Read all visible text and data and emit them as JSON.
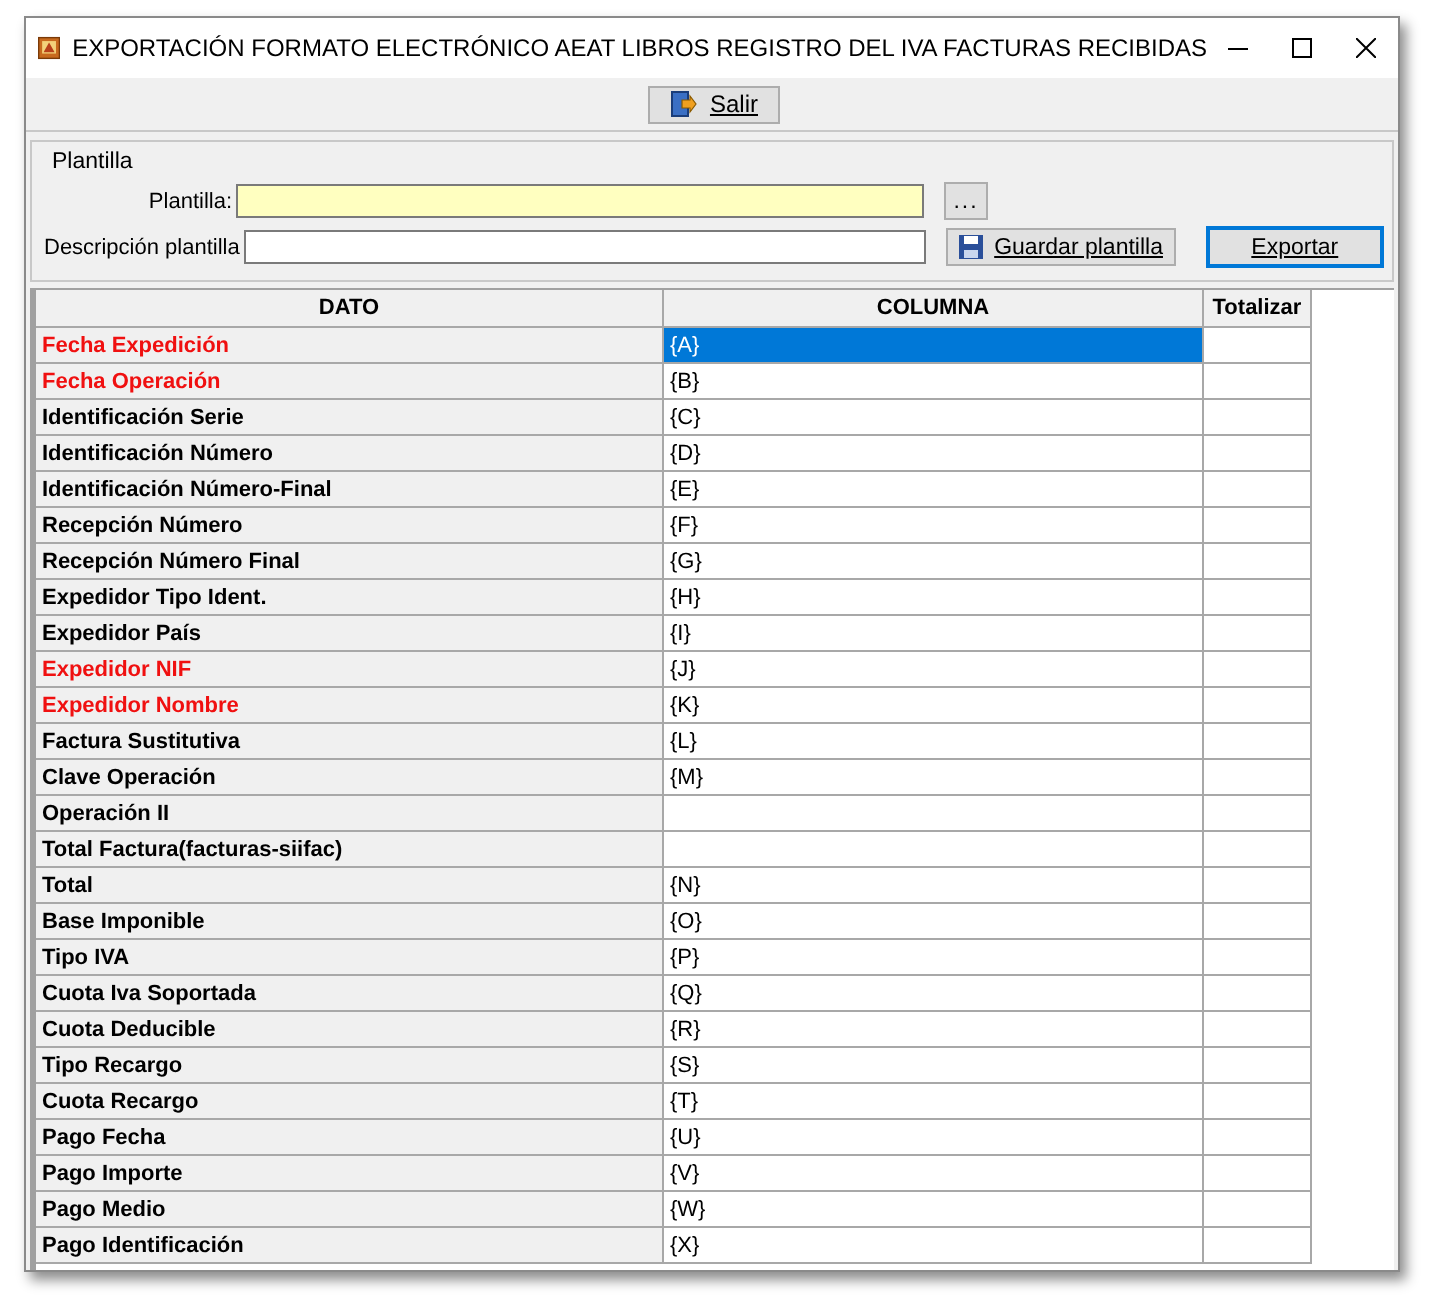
{
  "window": {
    "title": "EXPORTACIÓN FORMATO ELECTRÓNICO AEAT LIBROS REGISTRO DEL IVA FACTURAS RECIBIDAS"
  },
  "toolbar": {
    "exit_button": "Salir"
  },
  "template_group": {
    "title": "Plantilla",
    "template_label": "Plantilla:",
    "browse_button": "...",
    "description_label": "Descripción plantilla",
    "save_button": "Guardar plantilla",
    "export_button": "Exportar"
  },
  "table": {
    "columns": [
      "DATO",
      "COLUMNA",
      "Totalizar"
    ],
    "rows": [
      {
        "dato": "Fecha Expedición",
        "columna": "{A}",
        "required": true,
        "selected": true
      },
      {
        "dato": "Fecha Operación",
        "columna": "{B}",
        "required": true,
        "selected": false
      },
      {
        "dato": "Identificación Serie",
        "columna": "{C}",
        "required": false,
        "selected": false
      },
      {
        "dato": "Identificación Número",
        "columna": "{D}",
        "required": false,
        "selected": false
      },
      {
        "dato": "Identificación Número-Final",
        "columna": "{E}",
        "required": false,
        "selected": false
      },
      {
        "dato": "Recepción Número",
        "columna": "{F}",
        "required": false,
        "selected": false
      },
      {
        "dato": "Recepción Número Final",
        "columna": "{G}",
        "required": false,
        "selected": false
      },
      {
        "dato": "Expedidor Tipo Ident.",
        "columna": "{H}",
        "required": false,
        "selected": false
      },
      {
        "dato": "Expedidor País",
        "columna": "{I}",
        "required": false,
        "selected": false
      },
      {
        "dato": "Expedidor NIF",
        "columna": "{J}",
        "required": true,
        "selected": false
      },
      {
        "dato": "Expedidor Nombre",
        "columna": "{K}",
        "required": true,
        "selected": false
      },
      {
        "dato": "Factura Sustitutiva",
        "columna": "{L}",
        "required": false,
        "selected": false
      },
      {
        "dato": "Clave Operación",
        "columna": "{M}",
        "required": false,
        "selected": false
      },
      {
        "dato": "Operación II",
        "required": false,
        "selected": false
      },
      {
        "dato": "Total Factura(facturas-siifac)",
        "required": false,
        "selected": false
      },
      {
        "dato": "Total",
        "columna": "{N}",
        "required": false,
        "selected": false
      },
      {
        "dato": "Base Imponible",
        "columna": "{O}",
        "required": false,
        "selected": false
      },
      {
        "dato": "Tipo IVA",
        "columna": "{P}",
        "required": false,
        "selected": false
      },
      {
        "dato": "Cuota Iva Soportada",
        "columna": "{Q}",
        "required": false,
        "selected": false
      },
      {
        "dato": "Cuota Deducible",
        "columna": "{R}",
        "required": false,
        "selected": false
      },
      {
        "dato": "Tipo Recargo",
        "columna": "{S}",
        "required": false,
        "selected": false
      },
      {
        "dato": "Cuota Recargo",
        "columna": "{T}",
        "required": false,
        "selected": false
      },
      {
        "dato": "Pago Fecha",
        "columna": "{U}",
        "required": false,
        "selected": false
      },
      {
        "dato": "Pago Importe",
        "columna": "{V}",
        "required": false,
        "selected": false
      },
      {
        "dato": "Pago Medio",
        "columna": "{W}",
        "required": false,
        "selected": false
      },
      {
        "dato": "Pago Identificación",
        "columna": "{X}",
        "required": false,
        "selected": false
      }
    ]
  }
}
